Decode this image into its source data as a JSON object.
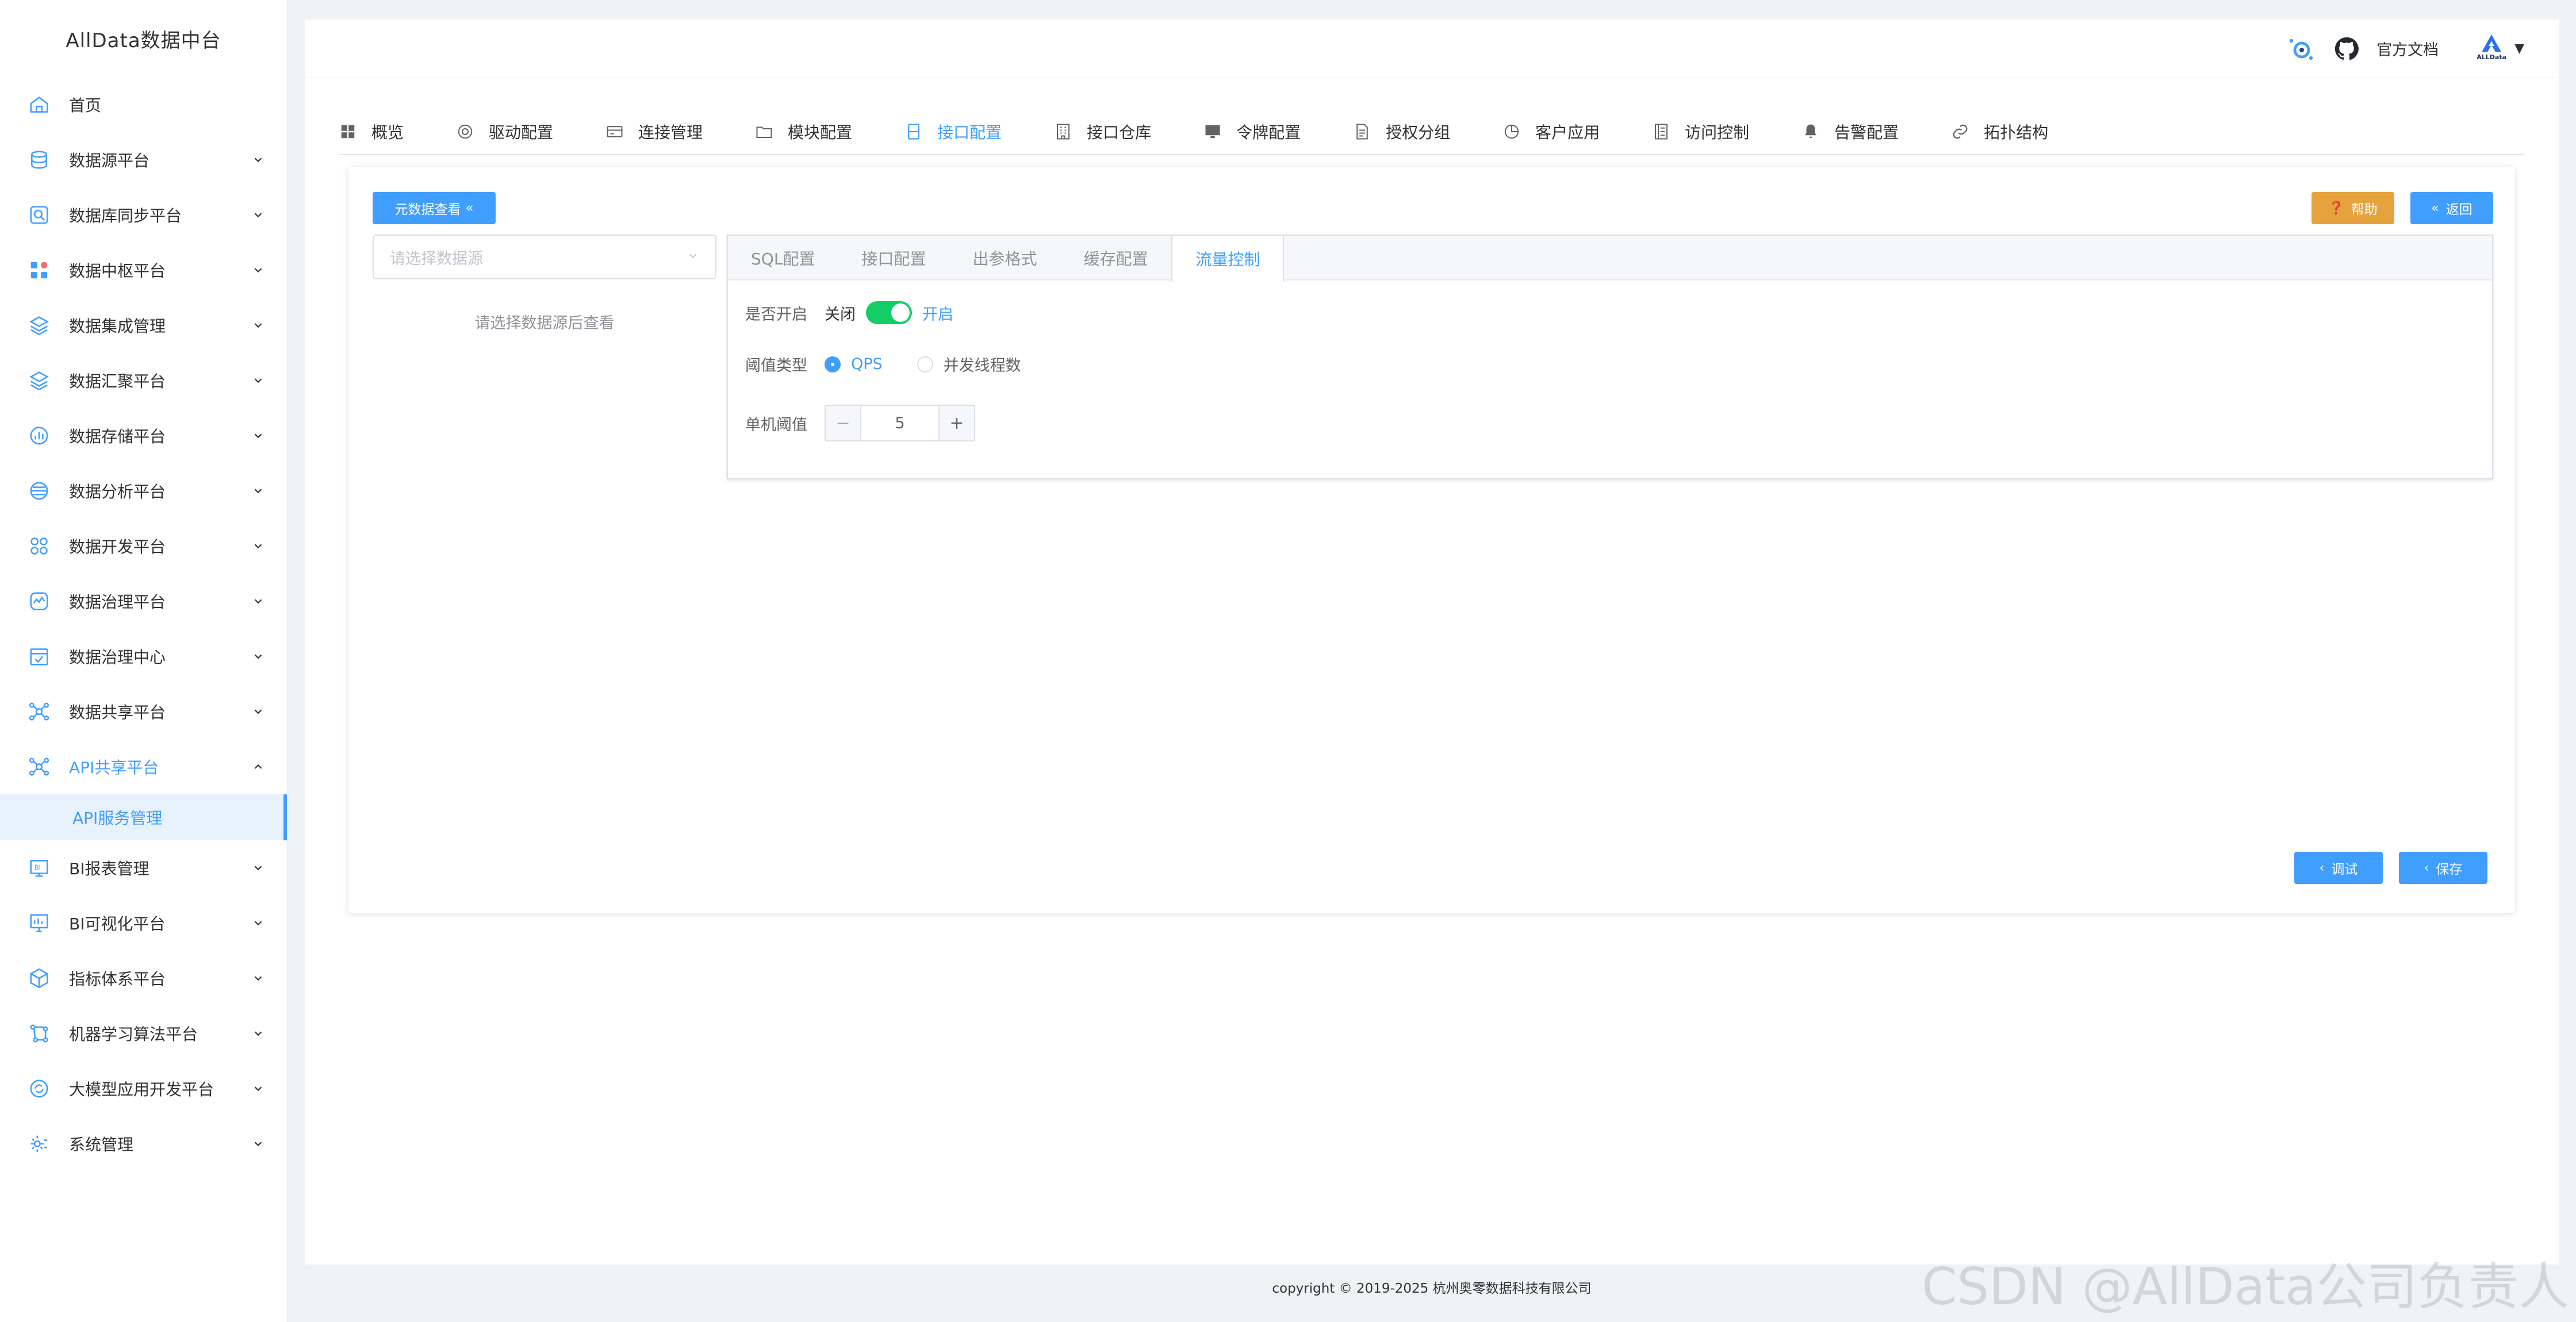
{
  "app": {
    "brand": "AllData数据中台"
  },
  "sidebar": {
    "items": [
      {
        "label": "首页",
        "icon": "home-icon",
        "has_arrow": false
      },
      {
        "label": "数据源平台",
        "icon": "database-icon",
        "has_arrow": true
      },
      {
        "label": "数据库同步平台",
        "icon": "sync-icon",
        "has_arrow": true
      },
      {
        "label": "数据中枢平台",
        "icon": "hub-icon",
        "has_arrow": true
      },
      {
        "label": "数据集成管理",
        "icon": "layers-icon",
        "has_arrow": true
      },
      {
        "label": "数据汇聚平台",
        "icon": "layers-icon",
        "has_arrow": true
      },
      {
        "label": "数据存储平台",
        "icon": "chart-icon",
        "has_arrow": true
      },
      {
        "label": "数据分析平台",
        "icon": "analysis-icon",
        "has_arrow": true
      },
      {
        "label": "数据开发平台",
        "icon": "grid-icon",
        "has_arrow": true
      },
      {
        "label": "数据治理平台",
        "icon": "pulse-icon",
        "has_arrow": true
      },
      {
        "label": "数据治理中心",
        "icon": "calendar-check-icon",
        "has_arrow": true
      },
      {
        "label": "数据共享平台",
        "icon": "network-icon",
        "has_arrow": true
      },
      {
        "label": "API共享平台",
        "icon": "network-icon",
        "has_arrow": true,
        "expanded": true
      },
      {
        "label": "BI报表管理",
        "icon": "bi-report-icon",
        "has_arrow": true
      },
      {
        "label": "BI可视化平台",
        "icon": "bi-screen-icon",
        "has_arrow": true
      },
      {
        "label": "指标体系平台",
        "icon": "cube-icon",
        "has_arrow": true
      },
      {
        "label": "机器学习算法平台",
        "icon": "ml-icon",
        "has_arrow": true
      },
      {
        "label": "大模型应用开发平台",
        "icon": "llm-icon",
        "has_arrow": true
      },
      {
        "label": "系统管理",
        "icon": "settings-icon",
        "has_arrow": true
      }
    ],
    "active_sub": "API服务管理"
  },
  "topbar": {
    "docs_label": "官方文档",
    "logo_text": "ALLData"
  },
  "nav_tabs": [
    {
      "label": "概览",
      "icon": "grid-icon"
    },
    {
      "label": "驱动配置",
      "icon": "driver-icon"
    },
    {
      "label": "连接管理",
      "icon": "card-icon"
    },
    {
      "label": "模块配置",
      "icon": "folder-icon"
    },
    {
      "label": "接口配置",
      "icon": "api-doc-icon",
      "active": true
    },
    {
      "label": "接口仓库",
      "icon": "building-icon"
    },
    {
      "label": "令牌配置",
      "icon": "monitor-icon"
    },
    {
      "label": "授权分组",
      "icon": "document-icon"
    },
    {
      "label": "客户应用",
      "icon": "pie-icon"
    },
    {
      "label": "访问控制",
      "icon": "list-doc-icon"
    },
    {
      "label": "告警配置",
      "icon": "bell-icon"
    },
    {
      "label": "拓扑结构",
      "icon": "link-icon"
    }
  ],
  "card": {
    "meta_button": "元数据查看",
    "help_button": "帮助",
    "back_button": "返回",
    "debug_button": "调试",
    "save_button": "保存",
    "ds_select_placeholder": "请选择数据源",
    "ds_empty_text": "请选择数据源后查看",
    "config_tabs": [
      "SQL配置",
      "接口配置",
      "出参格式",
      "缓存配置",
      "流量控制"
    ],
    "active_config_tab": "流量控制",
    "form": {
      "enable_label": "是否开启",
      "enable_off": "关闭",
      "enable_on": "开启",
      "enabled": true,
      "threshold_type_label": "阈值类型",
      "threshold_options": [
        "QPS",
        "并发线程数"
      ],
      "threshold_selected": "QPS",
      "single_threshold_label": "单机阈值",
      "single_threshold_value": "5",
      "minus": "−",
      "plus": "+"
    }
  },
  "footer": {
    "copyright": "copyright © 2019-2025 杭州奥零数据科技有限公司"
  },
  "watermark": "CSDN @AllData公司负责人",
  "colors": {
    "primary": "#409eff",
    "warning": "#e6a23c",
    "switch_on": "#13ce66"
  }
}
